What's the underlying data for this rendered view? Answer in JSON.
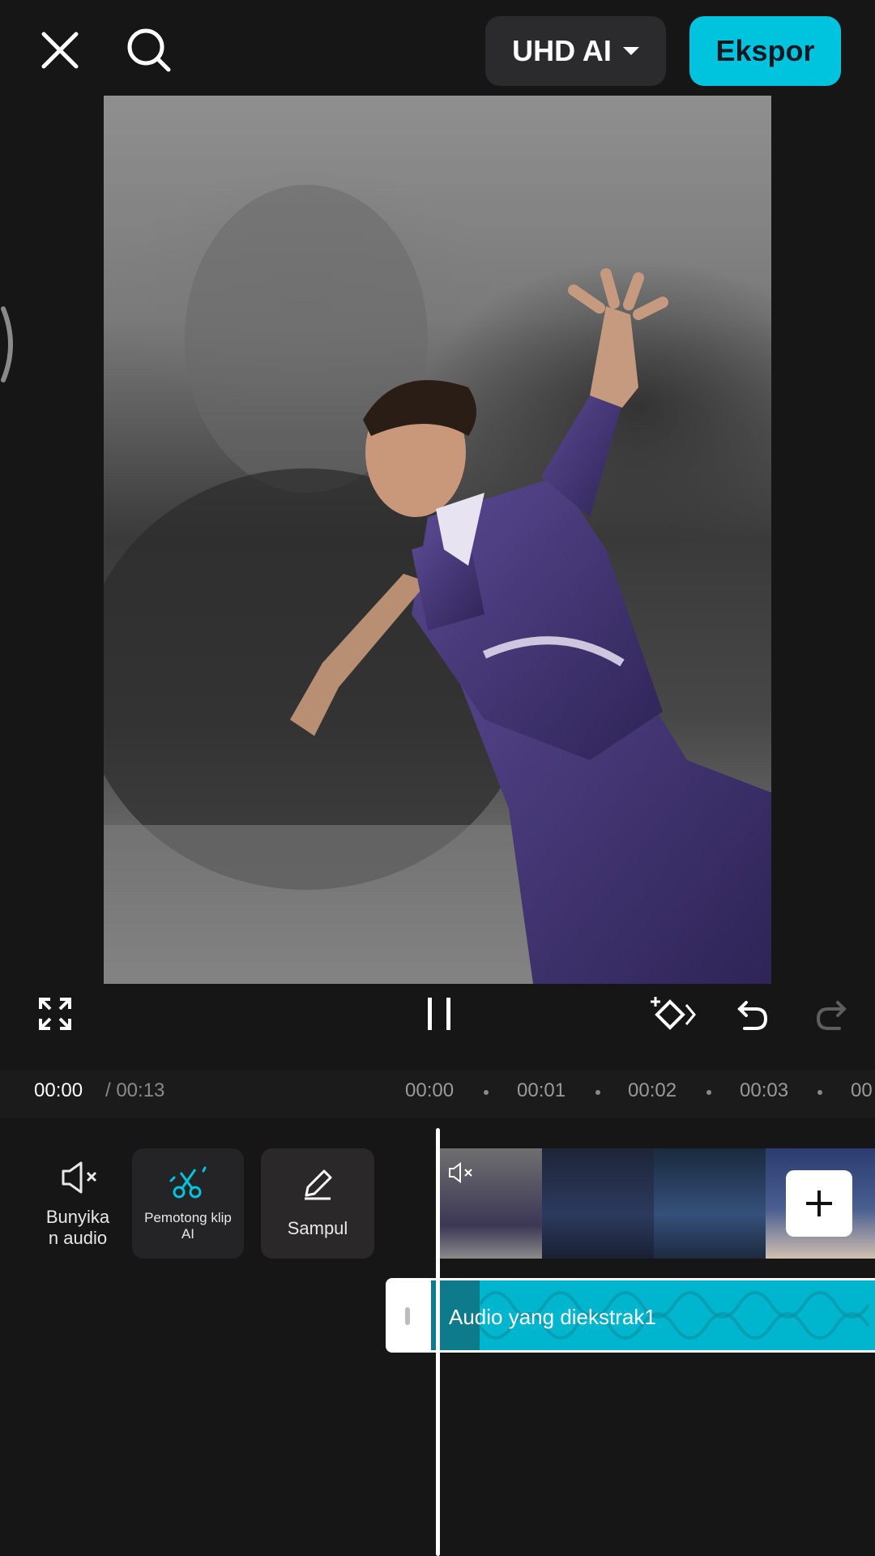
{
  "header": {
    "resolution_label": "UHD AI",
    "export_label": "Ekspor",
    "export_color": "#00c4de"
  },
  "icons": {
    "close": "close-icon",
    "search": "search-icon",
    "fullscreen": "fullscreen-icon",
    "pause": "pause-icon",
    "keyframe": "keyframe-icon",
    "undo": "undo-icon",
    "redo": "redo-icon",
    "mute": "mute-icon",
    "ai_cut": "scissors-icon",
    "edit": "pencil-icon",
    "add": "plus-icon"
  },
  "time": {
    "current": "00:00",
    "total": "/ 00:13",
    "ticks": [
      "00:00",
      "00:01",
      "00:02",
      "00:03",
      "00"
    ]
  },
  "tools": {
    "mute_audio": "Bunyika\nn audio",
    "ai_clip_cutter": "Pemotong klip\nAI",
    "cover": "Sampul"
  },
  "audio_track": {
    "label": "Audio yang diekstrak1",
    "color": "#00b6cf"
  }
}
